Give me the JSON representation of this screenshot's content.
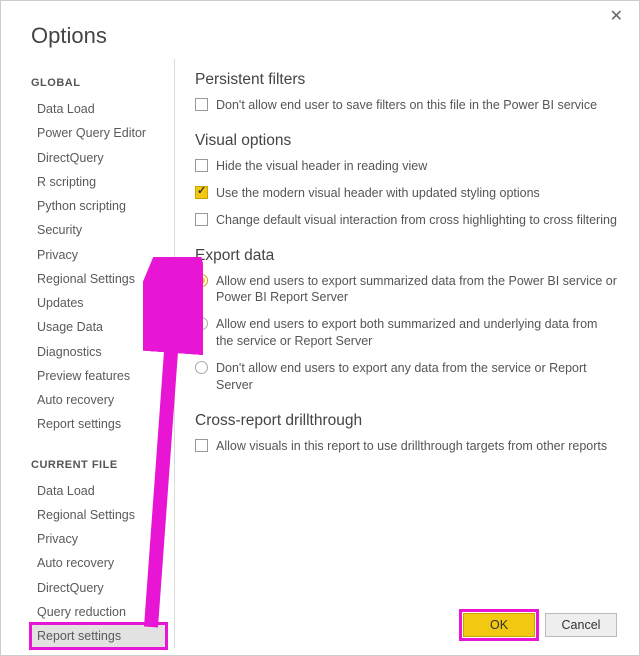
{
  "title": "Options",
  "sidebar": {
    "global_head": "GLOBAL",
    "global": [
      "Data Load",
      "Power Query Editor",
      "DirectQuery",
      "R scripting",
      "Python scripting",
      "Security",
      "Privacy",
      "Regional Settings",
      "Updates",
      "Usage Data",
      "Diagnostics",
      "Preview features",
      "Auto recovery",
      "Report settings"
    ],
    "current_head": "CURRENT FILE",
    "current": [
      "Data Load",
      "Regional Settings",
      "Privacy",
      "Auto recovery",
      "DirectQuery",
      "Query reduction",
      "Report settings"
    ]
  },
  "groups": {
    "persistent_head": "Persistent filters",
    "persistent_opt": "Don't allow end user to save filters on this file in the Power BI service",
    "visual_head": "Visual options",
    "visual_opt1": "Hide the visual header in reading view",
    "visual_opt2": "Use the modern visual header with updated styling options",
    "visual_opt3": "Change default visual interaction from cross highlighting to cross filtering",
    "export_head": "Export data",
    "export_opt1": "Allow end users to export summarized data from the Power BI service or Power BI Report Server",
    "export_opt2": "Allow end users to export both summarized and underlying data from the service or Report Server",
    "export_opt3": "Don't allow end users to export any data from the service or Report Server",
    "drill_head": "Cross-report drillthrough",
    "drill_opt": "Allow visuals in this report to use drillthrough targets from other reports"
  },
  "buttons": {
    "ok": "OK",
    "cancel": "Cancel"
  }
}
